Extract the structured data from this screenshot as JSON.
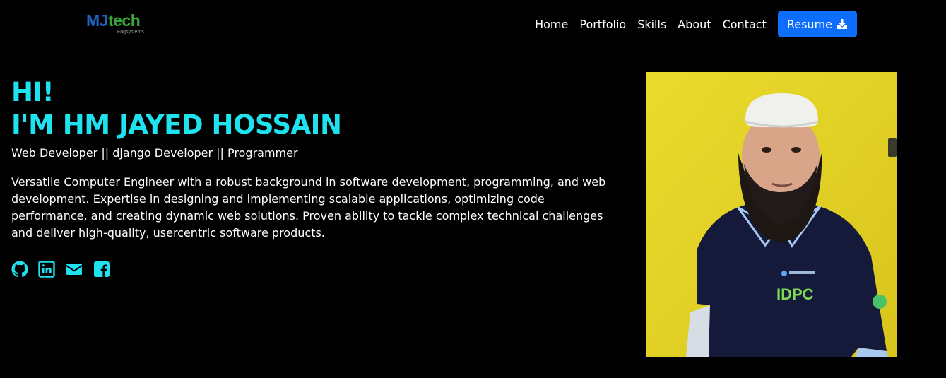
{
  "brand": {
    "logo_main": "MJtech",
    "logo_m": "M",
    "logo_j": "J",
    "logo_t": "tech",
    "logo_sub": "Fogsystems"
  },
  "nav": {
    "items": [
      "Home",
      "Portfolio",
      "Skills",
      "About",
      "Contact"
    ],
    "resume_label": "Resume",
    "resume_icon": "download-icon",
    "resume_color": "#0d6efd"
  },
  "hero": {
    "greeting": "HI!",
    "name_line": "I'M HM JAYED HOSSAIN",
    "roles": "Web Developer || django Developer || Programmer",
    "bio": "Versatile Computer Engineer with a robust background in software development, programming, and web development. Expertise in designing and implementing scalable applications, optimizing code performance, and creating dynamic web solutions. Proven ability to tackle complex technical challenges and deliver high-quality, usercentric software products.",
    "accent_color": "#1ee3ef"
  },
  "socials": [
    {
      "icon": "github-icon"
    },
    {
      "icon": "linkedin-icon"
    },
    {
      "icon": "envelope-icon"
    },
    {
      "icon": "facebook-icon"
    }
  ],
  "shirt_badge_text": "IDPC"
}
